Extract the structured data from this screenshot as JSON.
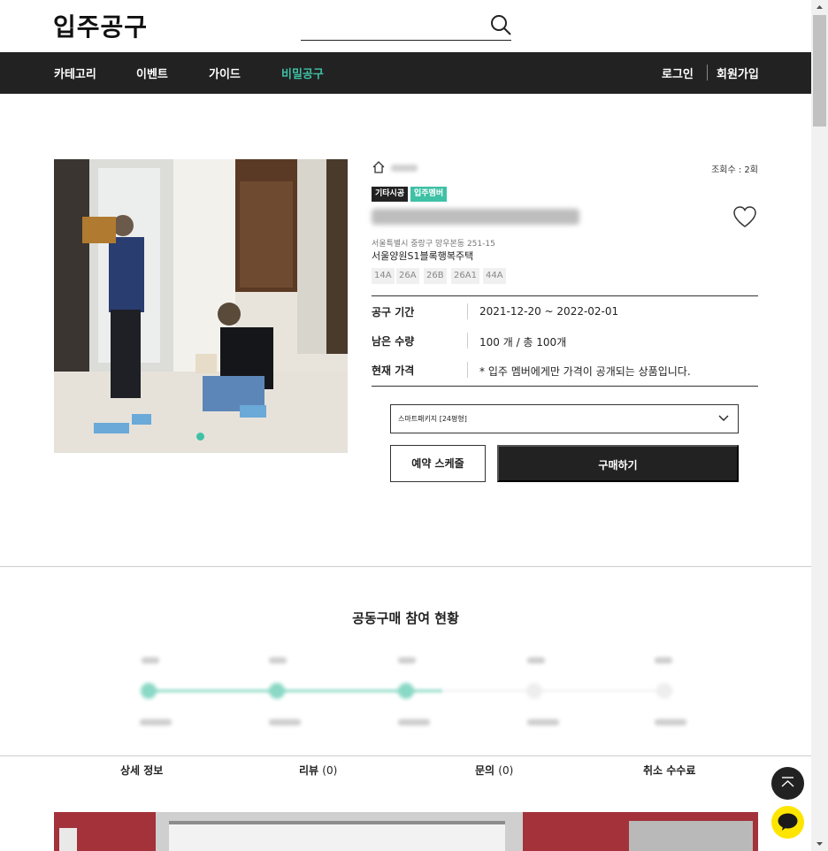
{
  "header": {
    "logo": "입주공구"
  },
  "nav": {
    "items": [
      "카테고리",
      "이벤트",
      "가이드",
      "비밀공구"
    ],
    "active_index": 3,
    "login": "로그인",
    "signup": "회원가입"
  },
  "product": {
    "views": "조회수 : 2회",
    "badges": [
      "기타시공",
      "입주멤버"
    ],
    "address": "서울특별시 중랑구 망우본동 251-15",
    "complex": "서울양원S1블록행복주택",
    "types": [
      "14A",
      "26A",
      "26B",
      "26A1",
      "44A"
    ],
    "info": {
      "period_label": "공구 기간",
      "period_value": "2021-12-20 ~ 2022-02-01",
      "remain_label": "남은 수량",
      "remain_value": "100 개 / 총 100개",
      "price_label": "현재 가격",
      "price_value": "* 입주 멤버에게만 가격이 공개되는 상품입니다."
    },
    "option_selected": "스마트패키지 [24평형]",
    "reserve_button": "예약 스케줄",
    "buy_button": "구매하기",
    "image_slide_index": 1,
    "image_slide_count": 1
  },
  "participation": {
    "title": "공동구매 참여 현황",
    "filled_steps": 3,
    "total_steps": 5
  },
  "tabs": [
    {
      "label": "상세 정보",
      "count": ""
    },
    {
      "label": "리뷰",
      "count": "(0)"
    },
    {
      "label": "문의",
      "count": "(0)"
    },
    {
      "label": "취소 수수료",
      "count": ""
    }
  ],
  "colors": {
    "accent": "#3fc1a5",
    "dark": "#222222",
    "kakao": "#fee500"
  }
}
